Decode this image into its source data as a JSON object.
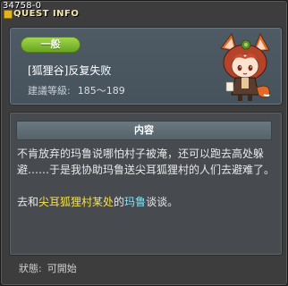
{
  "window": {
    "quest_id": "34758-0",
    "title": "QUEST INFO"
  },
  "summary": {
    "category": "一般",
    "quest_name": "[狐狸谷]反复失败",
    "level_label": "建議等級:",
    "level_range": "185～189",
    "portrait_icon": "fox-girl-npc-icon"
  },
  "content": {
    "header": "内容",
    "paragraph1": "不肯放弃的玛鲁说哪怕村子被淹，还可以跑去高处躲避……于是我协助玛鲁送尖耳狐狸村的人们去避难了。",
    "paragraph2_prefix": "去和",
    "paragraph2_location": "尖耳狐狸村某处",
    "paragraph2_mid": "的",
    "paragraph2_npc": "玛鲁",
    "paragraph2_suffix": "谈谈。"
  },
  "status": {
    "label": "狀態:",
    "value": "可開始"
  },
  "colors": {
    "badge_green": "#7bbf2c",
    "highlight_yellow": "#f4e04d",
    "highlight_cyan": "#7fe4ff"
  }
}
